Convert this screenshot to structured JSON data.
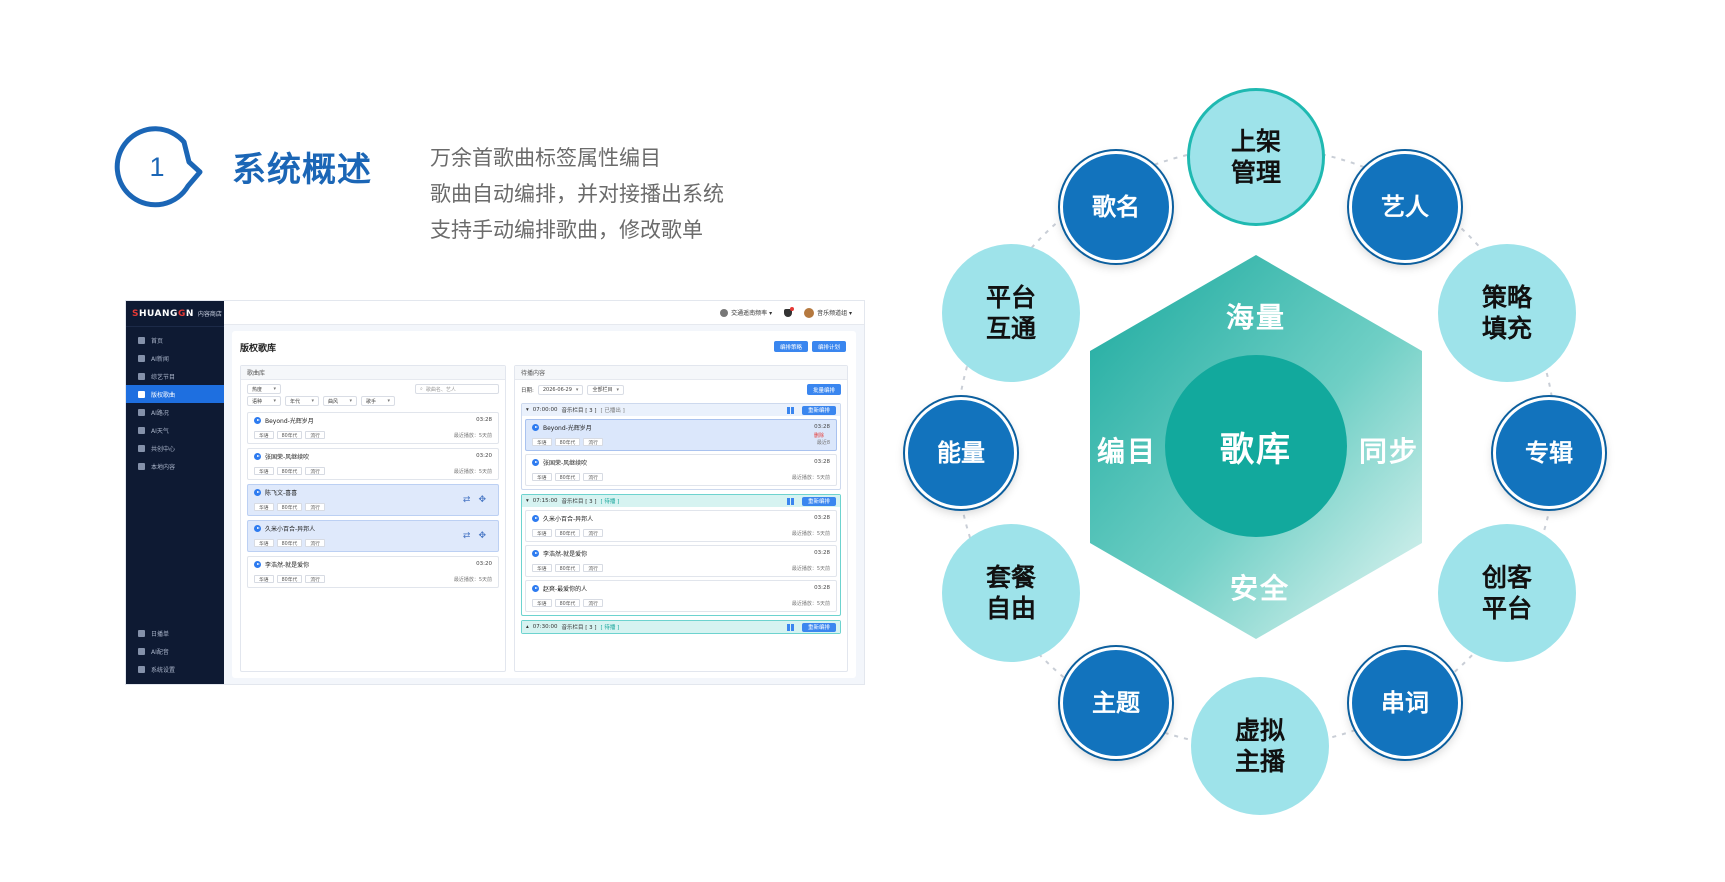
{
  "section": {
    "number": "1",
    "title": "系统概述",
    "description": [
      "万余首歌曲标签属性编目",
      "歌曲自动编排，并对接播出系统",
      "支持手动编排歌曲，修改歌单"
    ]
  },
  "app": {
    "logo": {
      "main_first": "S",
      "main_rest": "HUANG",
      "main_mark": "G",
      "main_end": "N",
      "sub": "内容商店"
    },
    "sidebar": {
      "items": [
        {
          "label": "首页"
        },
        {
          "label": "AI新闻"
        },
        {
          "label": "综艺节目"
        },
        {
          "label": "版权歌曲",
          "active": true
        },
        {
          "label": "AI路况"
        },
        {
          "label": "AI天气"
        },
        {
          "label": "共创中心"
        },
        {
          "label": "本地内容"
        }
      ],
      "bottom_items": [
        {
          "label": "日播单"
        },
        {
          "label": "AI配音"
        },
        {
          "label": "系统设置"
        }
      ]
    },
    "topbar": {
      "station": "交通遥南频率 ▾",
      "user": "音乐频道组 ▾"
    },
    "page_title": "版权歌库",
    "buttons": {
      "rules": "编排策略",
      "plan": "编排计划",
      "batch": "批量编排"
    },
    "left_panel": {
      "title": "歌曲库",
      "filters": [
        "热度",
        "语种",
        "年代",
        "曲风",
        "歌手"
      ],
      "search_placeholder": "歌曲名、艺人",
      "songs": [
        {
          "title": "Beyond-光辉岁月",
          "duration": "03:28",
          "tags": [
            "华语",
            "80年代",
            "流行"
          ],
          "last_played": "最近播放：5天前",
          "selected": false
        },
        {
          "title": "张国荣-风继续吹",
          "duration": "03:20",
          "tags": [
            "华语",
            "80年代",
            "流行"
          ],
          "last_played": "最近播放：5天前",
          "selected": false
        },
        {
          "title": "陈飞文-喜喜",
          "duration": "",
          "tags": [
            "华语",
            "80年代",
            "流行"
          ],
          "last_played": "",
          "selected": true
        },
        {
          "title": "久米小百合-异邦人",
          "duration": "",
          "tags": [
            "华语",
            "80年代",
            "流行"
          ],
          "last_played": "",
          "selected": true
        },
        {
          "title": "李浩然-就是爱你",
          "duration": "03:20",
          "tags": [
            "华语",
            "80年代",
            "流行"
          ],
          "last_played": "最近播放：5天前",
          "selected": false
        }
      ]
    },
    "right_panel": {
      "title": "待播内容",
      "date_label": "日期:",
      "date_value": "2026-06-29",
      "column_filter": "全部栏目",
      "slots": [
        {
          "time": "07:00:00",
          "name": "音乐栏目 [ 3 ]",
          "state": "[ 已播出 ]",
          "action": "重新编排",
          "teal": false,
          "songs": [
            {
              "title": "Beyond-光辉岁月",
              "duration": "03:28",
              "tags": [
                "华语",
                "80年代",
                "流行"
              ],
              "last_played": "最近8",
              "delete": "删除",
              "pinned": true
            },
            {
              "title": "张国荣-风继续吹",
              "duration": "03:28",
              "tags": [
                "华语",
                "80年代",
                "流行"
              ],
              "last_played": "最近播放：5天前",
              "pinned": false
            }
          ]
        },
        {
          "time": "07:15:00",
          "name": "音乐栏目 [ 3 ]",
          "state": "[ 待播 ]",
          "action": "重新编排",
          "teal": true,
          "songs": [
            {
              "title": "久米小百合-异邦人",
              "duration": "03:28",
              "tags": [
                "华语",
                "80年代",
                "流行"
              ],
              "last_played": "最近播放：5天前",
              "pinned": false
            },
            {
              "title": "李浩然-就是爱你",
              "duration": "03:28",
              "tags": [
                "华语",
                "80年代",
                "流行"
              ],
              "last_played": "最近播放：5天前",
              "pinned": false
            },
            {
              "title": "赵爽-最爱你的人",
              "duration": "03:28",
              "tags": [
                "华语",
                "80年代",
                "流行"
              ],
              "last_played": "最近播放：5天前",
              "pinned": false
            }
          ]
        },
        {
          "time": "07:30:00",
          "name": "音乐栏目 [ 3 ]",
          "state": "[ 待播 ]",
          "action": "重新编排",
          "teal": true,
          "songs": []
        }
      ]
    }
  },
  "diagram": {
    "hub": "歌库",
    "hex_words": {
      "top": "海量",
      "left": "编目",
      "right": "同步",
      "bottom": "安全"
    },
    "nodes": {
      "n01": {
        "lines": [
          "上架",
          "管理"
        ],
        "style": "light"
      },
      "n02": {
        "lines": [
          "艺人"
        ],
        "style": "dark"
      },
      "n03": {
        "lines": [
          "策略",
          "填充"
        ],
        "style": "light"
      },
      "n04": {
        "lines": [
          "专辑"
        ],
        "style": "dark"
      },
      "n05": {
        "lines": [
          "创客",
          "平台"
        ],
        "style": "light"
      },
      "n06": {
        "lines": [
          "串词"
        ],
        "style": "dark"
      },
      "n07": {
        "lines": [
          "虚拟",
          "主播"
        ],
        "style": "light"
      },
      "n08": {
        "lines": [
          "主题"
        ],
        "style": "dark"
      },
      "n09": {
        "lines": [
          "套餐",
          "自由"
        ],
        "style": "light"
      },
      "n10": {
        "lines": [
          "能量"
        ],
        "style": "dark"
      },
      "n11": {
        "lines": [
          "平台",
          "互通"
        ],
        "style": "light"
      },
      "n12": {
        "lines": [
          "歌名"
        ],
        "style": "dark"
      }
    }
  },
  "colors": {
    "brand_blue": "#1b66b6",
    "teal": "#12a99d",
    "node_light": "#9ee3ea",
    "node_dark": "#1273bd",
    "app_accent": "#3a86ef"
  }
}
